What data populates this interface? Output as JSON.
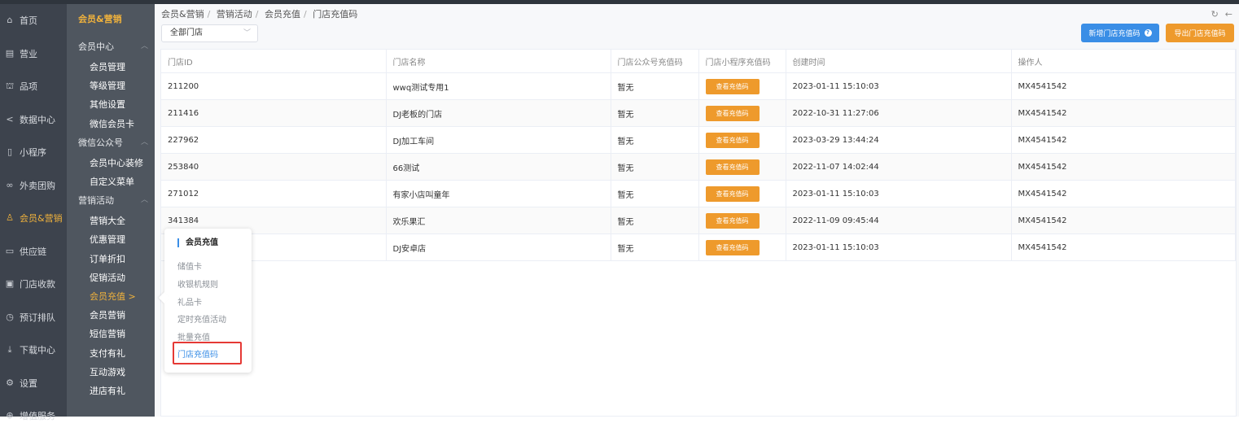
{
  "nav1": [
    {
      "label": "首页",
      "icon": "home-icon",
      "glyph": "⌂"
    },
    {
      "label": "营业",
      "icon": "calendar-icon",
      "glyph": "▤"
    },
    {
      "label": "品项",
      "icon": "bag-icon",
      "glyph": "⛫"
    },
    {
      "label": "数据中心",
      "icon": "share-icon",
      "glyph": "<"
    },
    {
      "label": "小程序",
      "icon": "phone-icon",
      "glyph": "▯"
    },
    {
      "label": "外卖团购",
      "icon": "bike-icon",
      "glyph": "∞"
    },
    {
      "label": "会员&营销",
      "icon": "user-icon",
      "glyph": "♙",
      "active": true
    },
    {
      "label": "供应链",
      "icon": "truck-icon",
      "glyph": "▭"
    },
    {
      "label": "门店收款",
      "icon": "wallet-icon",
      "glyph": "▣"
    },
    {
      "label": "预订排队",
      "icon": "clock-icon",
      "glyph": "◷"
    },
    {
      "label": "下载中心",
      "icon": "download-icon",
      "glyph": "⤓"
    },
    {
      "label": "设置",
      "icon": "gear-icon",
      "glyph": "⚙"
    },
    {
      "label": "增值服务",
      "icon": "plus-icon",
      "glyph": "⊕"
    }
  ],
  "nav2": {
    "header": "会员&营销",
    "groups": [
      {
        "label": "会员中心",
        "items": [
          "会员管理",
          "等级管理",
          "其他设置",
          "微信会员卡"
        ]
      },
      {
        "label": "微信公众号",
        "items": [
          "会员中心装修",
          "自定义菜单"
        ]
      },
      {
        "label": "营销活动",
        "items": [
          "营销大全",
          "优惠管理",
          "订单折扣",
          "促销活动",
          "会员充值 >",
          "会员营销",
          "短信营销",
          "支付有礼",
          "互动游戏",
          "进店有礼"
        ]
      }
    ]
  },
  "breadcrumb": [
    "会员&营销",
    "营销活动",
    "会员充值",
    "门店充值码"
  ],
  "toolbar": {
    "store_select": "全部门店",
    "new_button": "新增门店充值码",
    "export_button": "导出门店充值码"
  },
  "table": {
    "columns": [
      "门店ID",
      "门店名称",
      "门店公众号充值码",
      "门店小程序充值码",
      "创建时间",
      "操作人"
    ],
    "rows": [
      {
        "id": "211200",
        "name": "wwq测试专用1",
        "mp": "暂无",
        "mini": "查看充值码",
        "time": "2023-01-11 15:10:03",
        "op": "MX4541542"
      },
      {
        "id": "211416",
        "name": "DJ老板的门店",
        "mp": "暂无",
        "mini": "查看充值码",
        "time": "2022-10-31 11:27:06",
        "op": "MX4541542"
      },
      {
        "id": "227962",
        "name": "DJ加工车间",
        "mp": "暂无",
        "mini": "查看充值码",
        "time": "2023-03-29 13:44:24",
        "op": "MX4541542"
      },
      {
        "id": "253840",
        "name": "66测试",
        "mp": "暂无",
        "mini": "查看充值码",
        "time": "2022-11-07 14:02:44",
        "op": "MX4541542"
      },
      {
        "id": "271012",
        "name": "有家小店叫童年",
        "mp": "暂无",
        "mini": "查看充值码",
        "time": "2023-01-11 15:10:03",
        "op": "MX4541542"
      },
      {
        "id": "341384",
        "name": "欢乐果汇",
        "mp": "暂无",
        "mini": "查看充值码",
        "time": "2022-11-09 09:45:44",
        "op": "MX4541542"
      },
      {
        "id": "",
        "name": "DJ安卓店",
        "mp": "暂无",
        "mini": "查看充值码",
        "time": "2023-01-11 15:10:03",
        "op": "MX4541542"
      }
    ]
  },
  "popup": {
    "title": "会员充值",
    "items": [
      "储值卡",
      "收银机规则",
      "礼品卡",
      "定时充值活动",
      "批量充值",
      "门店充值码"
    ]
  }
}
